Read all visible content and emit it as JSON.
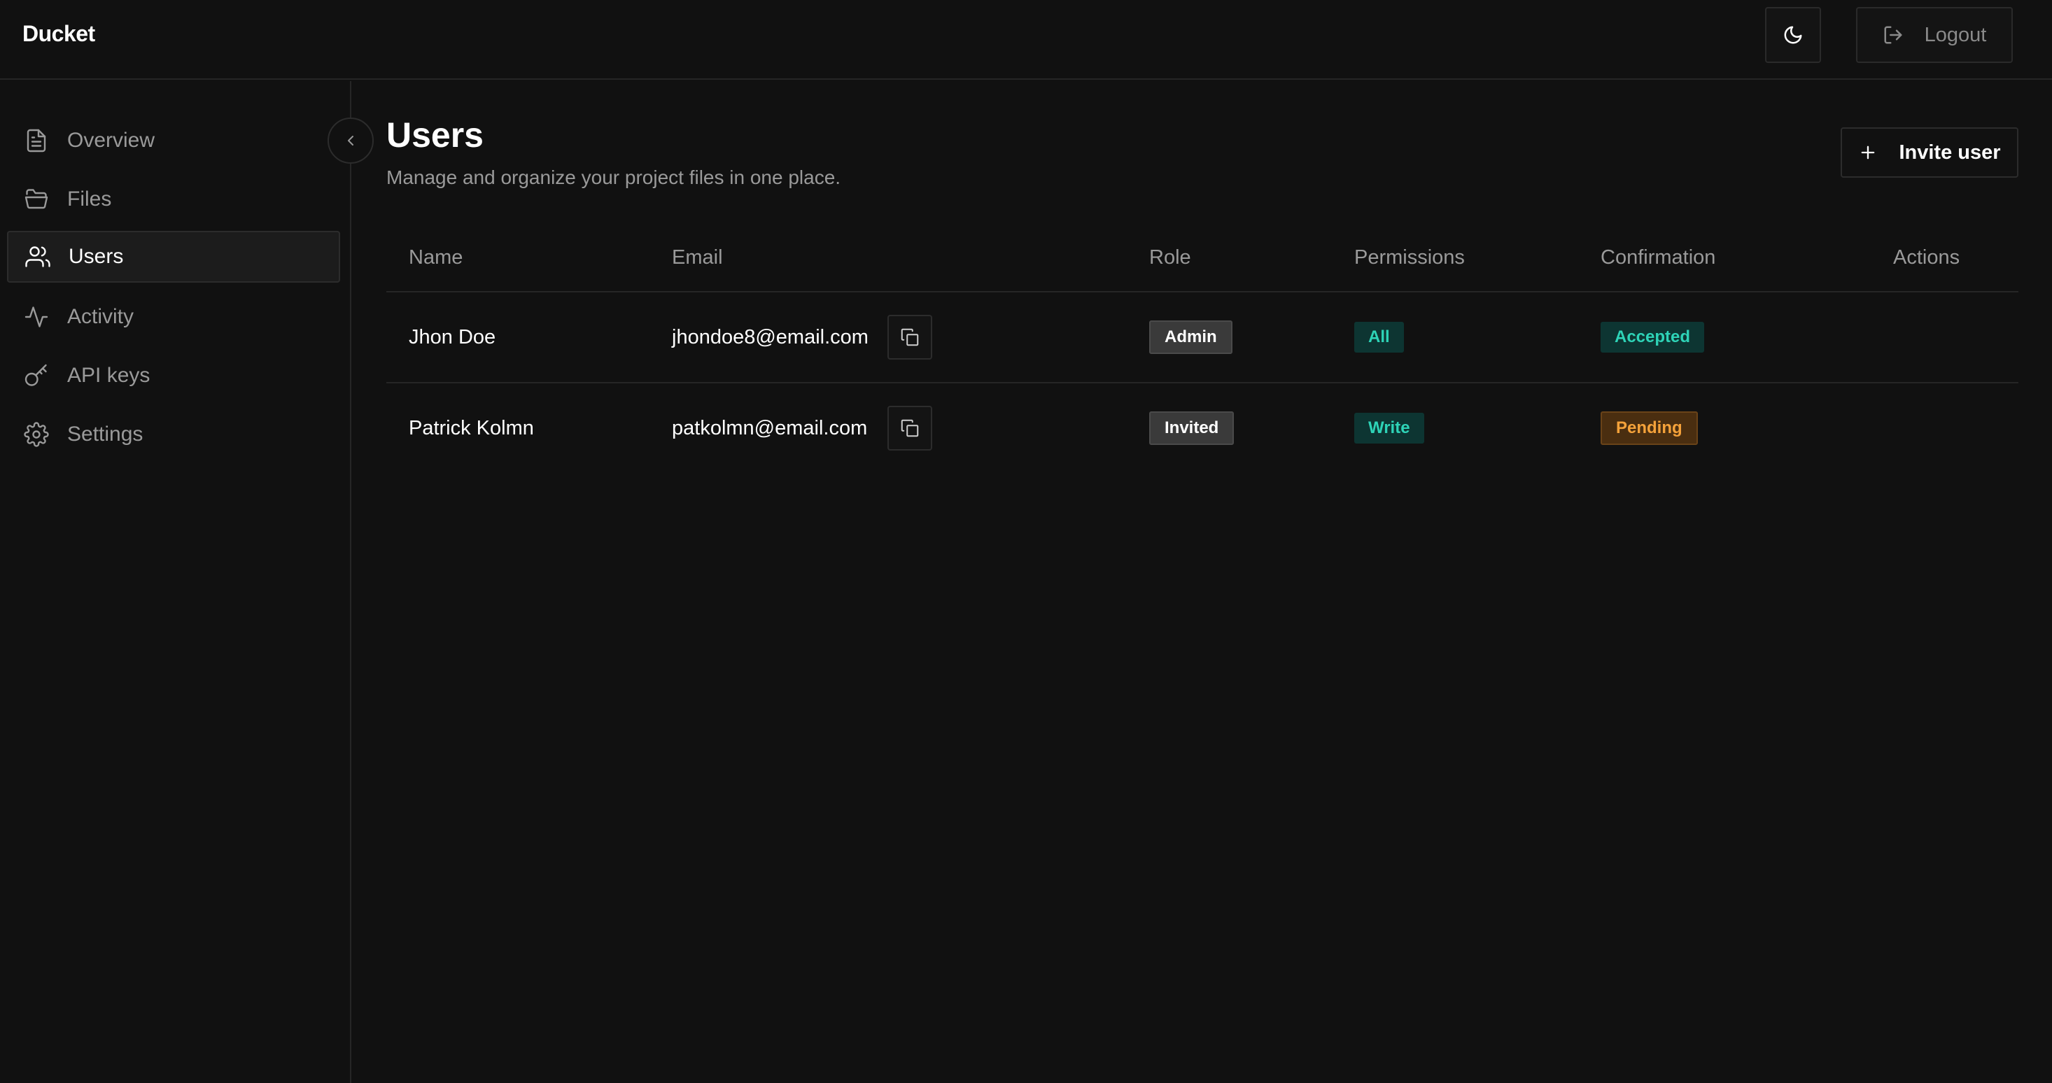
{
  "app": {
    "brand": "Ducket"
  },
  "header": {
    "logout_label": "Logout",
    "theme_icon": "moon-icon",
    "logout_icon": "logout-icon"
  },
  "sidebar": {
    "items": [
      {
        "label": "Overview",
        "icon": "file-icon",
        "active": false
      },
      {
        "label": "Files",
        "icon": "folder-icon",
        "active": false
      },
      {
        "label": "Users",
        "icon": "users-icon",
        "active": true
      },
      {
        "label": "Activity",
        "icon": "activity-icon",
        "active": false
      },
      {
        "label": "API keys",
        "icon": "key-icon",
        "active": false
      },
      {
        "label": "Settings",
        "icon": "gear-icon",
        "active": false
      }
    ],
    "collapse_icon": "chevron-left-icon"
  },
  "main": {
    "title": "Users",
    "subtitle": "Manage and organize your project files in one place.",
    "invite_label": "Invite user",
    "table": {
      "columns": [
        "Name",
        "Email",
        "Role",
        "Permissions",
        "Confirmation",
        "Actions"
      ],
      "rows": [
        {
          "name": "Jhon Doe",
          "email": "jhondoe8@email.com",
          "role": "Admin",
          "permissions": "All",
          "confirmation": "Accepted"
        },
        {
          "name": "Patrick Kolmn",
          "email": "patkolmn@email.com",
          "role": "Invited",
          "permissions": "Write",
          "confirmation": "Pending"
        }
      ]
    }
  },
  "colors": {
    "background": "#111111",
    "border": "#262626",
    "muted_text": "#9a9a9a",
    "teal_badge_text": "#2ed3b7",
    "teal_badge_bg": "#0d3532",
    "orange_badge_text": "#f5a23a",
    "orange_badge_bg": "#4a2e10"
  }
}
